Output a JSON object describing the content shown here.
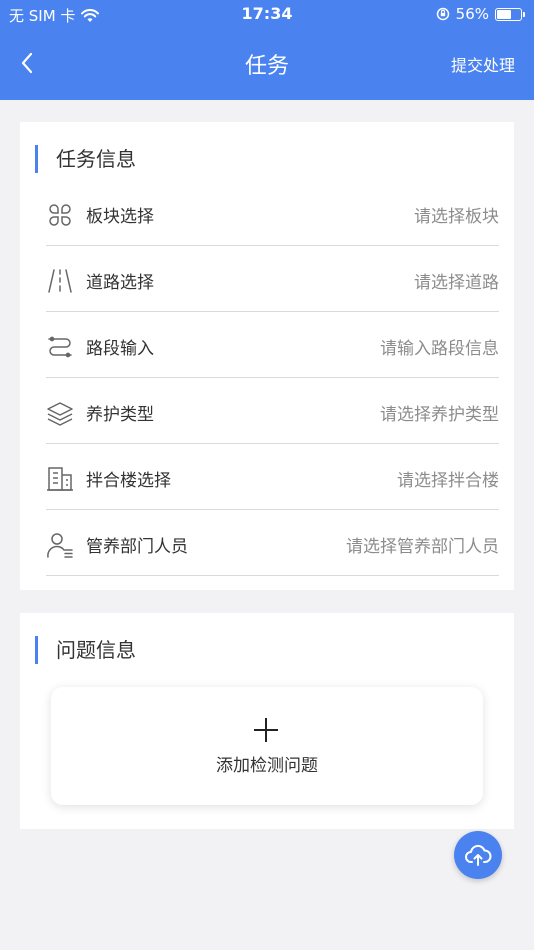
{
  "status_bar": {
    "carrier": "无 SIM 卡",
    "time": "17:34",
    "battery_percent": "56%",
    "battery_level": 0.56
  },
  "nav": {
    "title": "任务",
    "action_label": "提交处理"
  },
  "task_section": {
    "title": "任务信息",
    "rows": [
      {
        "icon": "grid-icon",
        "label": "板块选择",
        "value": "请选择板块"
      },
      {
        "icon": "road-icon",
        "label": "道路选择",
        "value": "请选择道路"
      },
      {
        "icon": "route-icon",
        "label": "路段输入",
        "value": "请输入路段信息"
      },
      {
        "icon": "layers-icon",
        "label": "养护类型",
        "value": "请选择养护类型"
      },
      {
        "icon": "building-icon",
        "label": "拌合楼选择",
        "value": "请选择拌合楼"
      },
      {
        "icon": "person-list-icon",
        "label": "管养部门人员",
        "value": "请选择管养部门人员"
      }
    ]
  },
  "issue_section": {
    "title": "问题信息",
    "add_label": "添加检测问题"
  },
  "fab": {
    "icon": "cloud-upload-icon"
  },
  "colors": {
    "accent": "#4a82f0",
    "background": "#f2f2f4"
  }
}
